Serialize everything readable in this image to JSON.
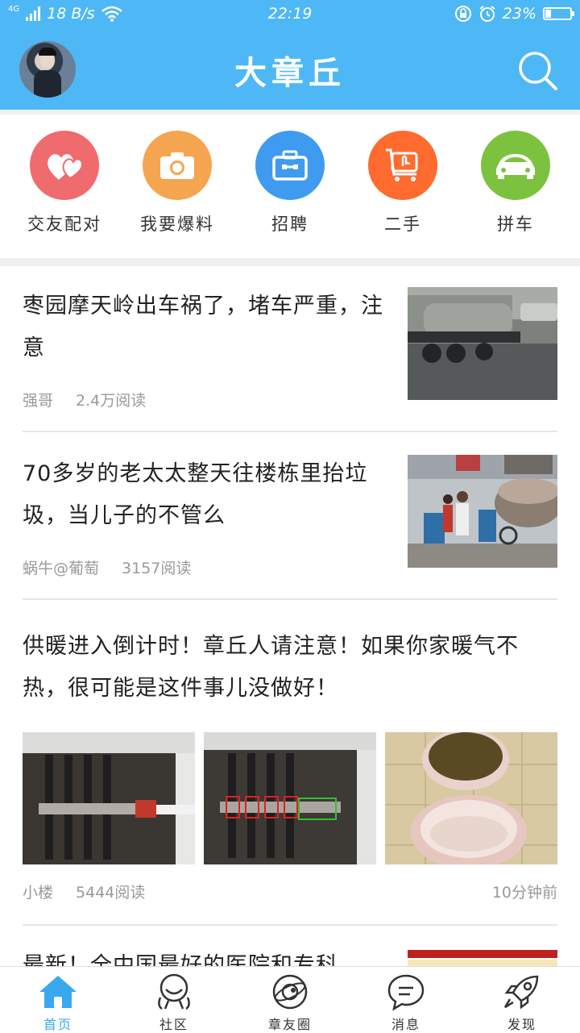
{
  "status_bar": {
    "network": "4G",
    "speed": "18 B/s",
    "time": "22:19",
    "battery": "23%",
    "battery_level": 0.23,
    "icons": [
      "signal-icon",
      "wifi-icon",
      "lock-rotation-icon",
      "alarm-icon",
      "battery-icon"
    ]
  },
  "header": {
    "title": "大章丘",
    "avatar": "avatar",
    "search_icon": "search-icon"
  },
  "quick_actions": [
    {
      "label": "交友配对",
      "icon": "hearts-icon",
      "color": "#f06b6e"
    },
    {
      "label": "我要爆料",
      "icon": "camera-icon",
      "color": "#f5a54f"
    },
    {
      "label": "招聘",
      "icon": "briefcase-icon",
      "color": "#3f9bf0"
    },
    {
      "label": "二手",
      "icon": "cart-icon",
      "color": "#ff6a2e"
    },
    {
      "label": "拼车",
      "icon": "car-icon",
      "color": "#7cc23f"
    }
  ],
  "articles": [
    {
      "title": "枣园摩天岭出车祸了，堵车严重，注意",
      "author": "强哥",
      "reads": "2.4万阅读",
      "time": ""
    },
    {
      "title": "70多岁的老太太整天往楼栋里抬垃圾，当儿子的不管么",
      "author": "蜗牛@葡萄",
      "reads": "3157阅读",
      "time": ""
    },
    {
      "title": "供暖进入倒计时！章丘人请注意！如果你家暖气不热，很可能是这件事儿没做好！",
      "author": "小楼",
      "reads": "5444阅读",
      "time": "10分钟前"
    },
    {
      "title": "最新！全中国最好的医院和专科",
      "author": "",
      "reads": "",
      "time": ""
    }
  ],
  "tabs": [
    {
      "label": "首页",
      "icon": "home-icon",
      "active": true
    },
    {
      "label": "社区",
      "icon": "community-icon",
      "active": false
    },
    {
      "label": "章友圈",
      "icon": "planet-icon",
      "active": false
    },
    {
      "label": "消息",
      "icon": "message-icon",
      "active": false
    },
    {
      "label": "发现",
      "icon": "rocket-icon",
      "active": false
    }
  ],
  "colors": {
    "brand": "#4db8f5",
    "active_tab": "#39a8ef",
    "meta_text": "#999999"
  }
}
